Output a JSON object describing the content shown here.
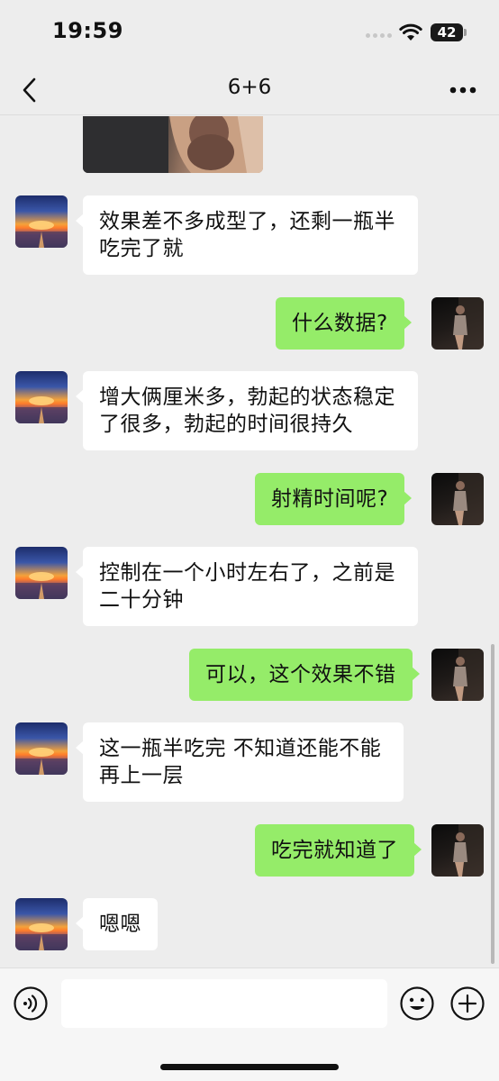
{
  "status_bar": {
    "time": "19:59",
    "battery": "42"
  },
  "header": {
    "title": "6+6"
  },
  "messages": [
    {
      "side": "in",
      "text": "效果差不多成型了，还剩一瓶半吃完了就"
    },
    {
      "side": "out",
      "text": "什么数据?"
    },
    {
      "side": "in",
      "text": "增大俩厘米多，勃起的状态稳定了很多，勃起的时间很持久"
    },
    {
      "side": "out",
      "text": "射精时间呢?"
    },
    {
      "side": "in",
      "text": "控制在一个小时左右了，之前是二十分钟"
    },
    {
      "side": "out",
      "text": "可以，这个效果不错"
    },
    {
      "side": "in",
      "text": "这一瓶半吃完 不知道还能不能再上一层"
    },
    {
      "side": "out",
      "text": "吃完就知道了"
    },
    {
      "side": "in",
      "text": "嗯嗯"
    }
  ],
  "input": {
    "value": ""
  },
  "colors": {
    "background": "#ededed",
    "outgoing_bubble": "#95ec69",
    "incoming_bubble": "#ffffff"
  },
  "icons": [
    "back-icon",
    "more-icon",
    "voice-icon",
    "emoji-icon",
    "plus-icon",
    "wifi-icon",
    "battery-icon"
  ]
}
